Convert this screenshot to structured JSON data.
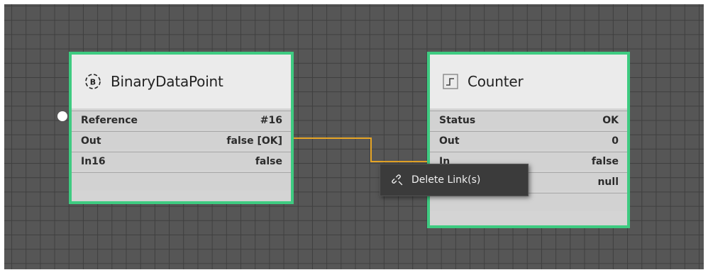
{
  "nodes": {
    "binary": {
      "title": "BinaryDataPoint",
      "icon": "binary-datapoint-icon",
      "rows": [
        {
          "name": "Reference",
          "value": "#16"
        },
        {
          "name": "Out",
          "value": "false [OK]"
        },
        {
          "name": "In16",
          "value": "false"
        }
      ]
    },
    "counter": {
      "title": "Counter",
      "icon": "counter-icon",
      "rows": [
        {
          "name": "Status",
          "value": "OK"
        },
        {
          "name": "Out",
          "value": "0"
        },
        {
          "name": "In",
          "value": "false"
        },
        {
          "name": "",
          "value": "null"
        }
      ]
    }
  },
  "context_menu": {
    "items": [
      {
        "label": "Delete Link(s)",
        "icon": "unlink-icon"
      }
    ]
  },
  "colors": {
    "canvas": "#565656",
    "grid": "#3f3f3f",
    "node_border": "#3ecb81",
    "link": "#e6a526"
  }
}
